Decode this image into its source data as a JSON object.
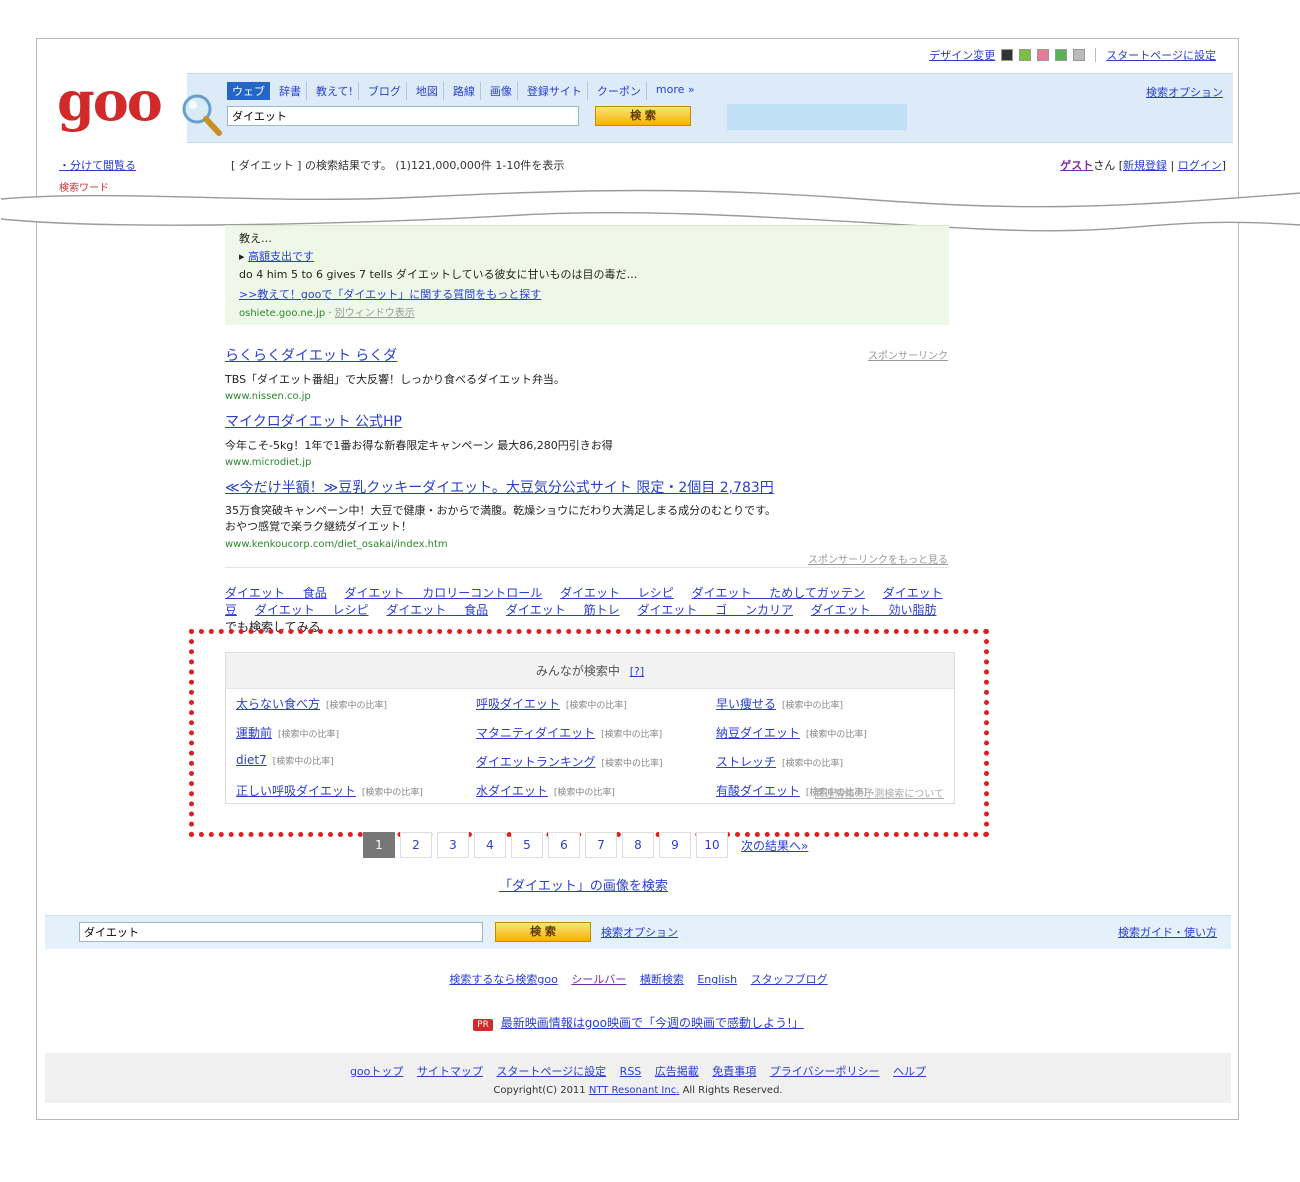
{
  "top_util": {
    "design_label": "デザイン変更",
    "swatches": [
      "#333333",
      "#7ac143",
      "#e87b9a",
      "#57b157",
      "#bbbbbb"
    ],
    "start_page": "スタートページに設定"
  },
  "header": {
    "logo": "goo",
    "tabs": [
      "ウェブ",
      "辞書",
      "教えて!",
      "ブログ",
      "地図",
      "路線",
      "画像",
      "登録サイト",
      "クーポン",
      "more »"
    ],
    "search_options": "検索オプション",
    "query": "ダイエット",
    "search_button": "検 索"
  },
  "summary_row": {
    "side_link": "・分けて閲覧る",
    "side_sub": "検索ワード",
    "summary": "[ ダイエット ] の検索結果です。 (1)121,000,000件 1-10件を表示",
    "guest": "ゲスト",
    "san": "さん",
    "register": "新規登録",
    "login": "ログイン"
  },
  "qa_box": {
    "cut_text": "教え…",
    "bullet_title": "高額支出です",
    "snippet": "do 4 him 5 to 6 gives 7 tells ダイエットしている彼女に甘いものは目の毒だ…",
    "more_link": ">>教えて！gooで「ダイエット」に関する質問をもっと探す",
    "url": "oshiete.goo.ne.jp",
    "new_window": "別ウィンドウ表示"
  },
  "ads": {
    "label": "スポンサーリンク",
    "more": "スポンサーリンクをもっと見る",
    "items": [
      {
        "title": "らくらくダイエット らくダ",
        "desc": "TBS「ダイエット番組」で大反響！しっかり食べるダイエット弁当。",
        "url": "www.nissen.co.jp"
      },
      {
        "title": "マイクロダイエット 公式HP",
        "desc": "今年こそ-5kg！1年で1番お得な新春限定キャンペーン 最大86,280円引きお得",
        "url": "www.microdiet.jp"
      },
      {
        "title": "≪今だけ半額！≫豆乳クッキーダイエット。大豆気分公式サイト 限定・2個目 2,783円",
        "desc": "35万食突破キャンペーン中！大豆で健康・おからで満腹。乾燥ショウにだわり大満足しまる成分のむとりです。おやつ感覚で楽ラク継続ダイエット！",
        "url": "www.kenkoucorp.com/diet_osakai/index.htm"
      }
    ]
  },
  "related": {
    "keywords": [
      "ダイエット 食品",
      "ダイエット カロリーコントロール",
      "ダイエット レシピ",
      "ダイエット ためしてガッテン",
      "ダイエット 豆",
      "ダイエット レシピ",
      "ダイエット 食品",
      "ダイエット 筋トレ",
      "ダイエット ゴ ンカリア",
      "ダイエット 効い脂肪"
    ],
    "suffix": "でも検索してみる"
  },
  "trending": {
    "title": "みんなが検索中",
    "help": "[?]",
    "items": [
      {
        "k": "太らない食べ方",
        "c": "[検索中の比率]"
      },
      {
        "k": "呼吸ダイエット",
        "c": "[検索中の比率]"
      },
      {
        "k": "早い痩せる",
        "c": "[検索中の比率]"
      },
      {
        "k": "運動前",
        "c": "[検索中の比率]"
      },
      {
        "k": "マタニティダイエット",
        "c": "[検索中の比率]"
      },
      {
        "k": "納豆ダイエット",
        "c": "[検索中の比率]"
      },
      {
        "k": "diet7",
        "c": "[検索中の比率]"
      },
      {
        "k": "ダイエットランキング",
        "c": "[検索中の比率]"
      },
      {
        "k": "ストレッチ",
        "c": "[検索中の比率]"
      },
      {
        "k": "正しい呼吸ダイエット",
        "c": "[検索中の比率]"
      },
      {
        "k": "水ダイエット",
        "c": "[検索中の比率]"
      },
      {
        "k": "有酸ダイエット",
        "c": "[検索中の比率]"
      }
    ],
    "note": "関連情報の予測検索について"
  },
  "pager": {
    "pages": [
      "1",
      "2",
      "3",
      "4",
      "5",
      "6",
      "7",
      "8",
      "9",
      "10"
    ],
    "next": "次の結果へ»"
  },
  "image_search": "「ダイエット」の画像を検索",
  "bottom": {
    "query": "ダイエット",
    "button": "検 索",
    "options": "検索オプション",
    "guide": "検索ガイド・使い方"
  },
  "footer_links": [
    "検索するなら"
  ],
  "footer_row": {
    "items": [
      "検索するなら検索goo",
      "シールバー",
      "横断検索",
      "English",
      "スタッフブログ"
    ]
  },
  "promo": {
    "badge": "PR",
    "text": "最新映画情報はgoo映画で「今週の映画で感動しよう!」"
  },
  "footer_nav": [
    "gooトップ",
    "サイトマップ",
    "スタートページに設定",
    "RSS",
    "広告掲載",
    "免責事項",
    "プライバシーポリシー",
    "ヘルプ"
  ],
  "copyright": {
    "prefix": "Copyright(C) 2011",
    "company": "NTT Resonant Inc.",
    "suffix": "All Rights Reserved."
  }
}
